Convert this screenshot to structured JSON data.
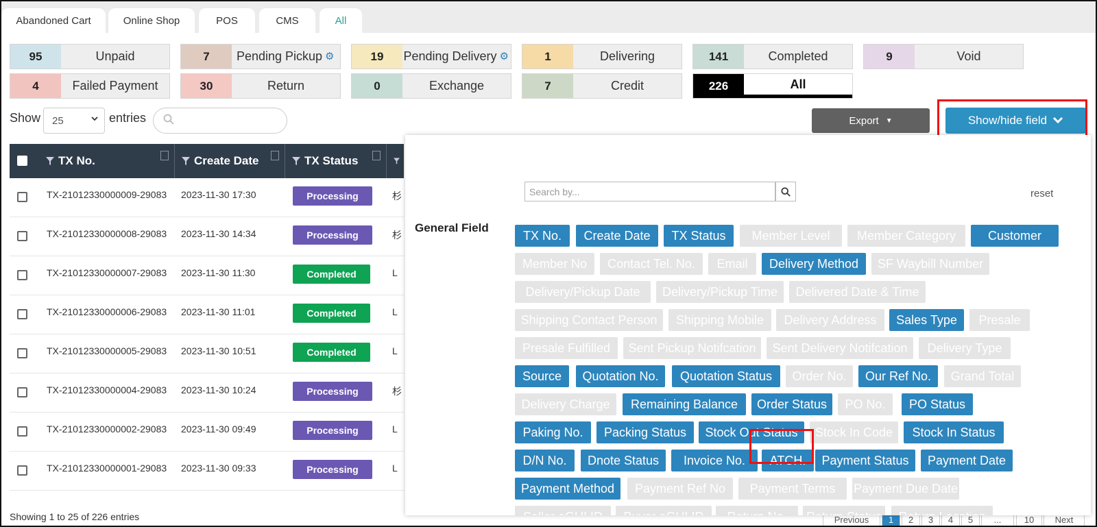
{
  "tabs": [
    "Abandoned Cart",
    "Online Shop",
    "POS",
    "CMS",
    "All"
  ],
  "active_tab": "All",
  "status_cards": [
    {
      "count": "95",
      "label": "Unpaid",
      "color": "#cfe3ea"
    },
    {
      "count": "7",
      "label": "Pending Pickup",
      "color": "#e0cbc1",
      "gear": true
    },
    {
      "count": "19",
      "label": "Pending Delivery",
      "color": "#f6e9bd",
      "gear": true
    },
    {
      "count": "1",
      "label": "Delivering",
      "color": "#f6dba6"
    },
    {
      "count": "141",
      "label": "Completed",
      "color": "#c9dcd6"
    },
    {
      "count": "9",
      "label": "Void",
      "color": "#e6d7e8"
    },
    {
      "count": "4",
      "label": "Failed Payment",
      "color": "#f2c4c0"
    },
    {
      "count": "30",
      "label": "Return",
      "color": "#f4c8c3"
    },
    {
      "count": "0",
      "label": "Exchange",
      "color": "#c6ddd6"
    },
    {
      "count": "7",
      "label": "Credit",
      "color": "#cdd9c6"
    },
    {
      "count": "226",
      "label": "All",
      "color": "#000000"
    }
  ],
  "controls": {
    "show_label": "Show",
    "entries_value": "25",
    "entries_label": "entries",
    "export_label": "Export",
    "showhide_label": "Show/hide field"
  },
  "table": {
    "headers": [
      "TX No.",
      "Create Date",
      "TX Status"
    ],
    "rows": [
      {
        "tx": "TX-21012330000009-29083",
        "date": "2023-11-30 17:30",
        "status": "Processing",
        "extra": "杉"
      },
      {
        "tx": "TX-21012330000008-29083",
        "date": "2023-11-30 14:34",
        "status": "Processing",
        "extra": "杉"
      },
      {
        "tx": "TX-21012330000007-29083",
        "date": "2023-11-30 11:30",
        "status": "Completed",
        "extra": "L"
      },
      {
        "tx": "TX-21012330000006-29083",
        "date": "2023-11-30 11:01",
        "status": "Completed",
        "extra": "L"
      },
      {
        "tx": "TX-21012330000005-29083",
        "date": "2023-11-30 10:51",
        "status": "Completed",
        "extra": "L"
      },
      {
        "tx": "TX-21012330000004-29083",
        "date": "2023-11-30 10:24",
        "status": "Processing",
        "extra": "杉"
      },
      {
        "tx": "TX-21012330000002-29083",
        "date": "2023-11-30 09:49",
        "status": "Processing",
        "extra": "L"
      },
      {
        "tx": "TX-21012330000001-29083",
        "date": "2023-11-30 09:33",
        "status": "Processing",
        "extra": "L"
      }
    ],
    "footer": "Showing 1 to 25 of 226 entries"
  },
  "pagination": [
    "Previous",
    "1",
    "2",
    "3",
    "4",
    "5",
    "...",
    "10",
    "Next"
  ],
  "panel": {
    "search_placeholder": "Search by...",
    "reset_label": "reset",
    "section_label": "General Field",
    "chips": [
      {
        "label": "TX No.",
        "on": true
      },
      {
        "label": "Create Date",
        "on": true
      },
      {
        "label": "TX Status",
        "on": true
      },
      {
        "label": "Member Level",
        "on": false
      },
      {
        "label": "Member Category",
        "on": false
      },
      {
        "label": "Customer",
        "on": true
      },
      {
        "label": "Member No",
        "on": false
      },
      {
        "label": "Contact Tel. No.",
        "on": false
      },
      {
        "label": "Email",
        "on": false
      },
      {
        "label": "Delivery Method",
        "on": true
      },
      {
        "label": "SF Waybill Number",
        "on": false
      },
      {
        "label": "Delivery/Pickup Date",
        "on": false
      },
      {
        "label": "Delivery/Pickup Time",
        "on": false
      },
      {
        "label": "Delivered Date & Time",
        "on": false
      },
      {
        "label": "Shipping Contact Person",
        "on": false
      },
      {
        "label": "Shipping Mobile",
        "on": false
      },
      {
        "label": "Delivery Address",
        "on": false
      },
      {
        "label": "Sales Type",
        "on": true
      },
      {
        "label": "Presale",
        "on": false
      },
      {
        "label": "Presale Fulfilled",
        "on": false
      },
      {
        "label": "Sent Pickup Notifcation",
        "on": false
      },
      {
        "label": "Sent Delivery Notifcation",
        "on": false
      },
      {
        "label": "Delivery Type",
        "on": false
      },
      {
        "label": "Source",
        "on": true
      },
      {
        "label": "Quotation No.",
        "on": true
      },
      {
        "label": "Quotation Status",
        "on": true
      },
      {
        "label": "Order No.",
        "on": false
      },
      {
        "label": "Our Ref No.",
        "on": true
      },
      {
        "label": "Grand Total",
        "on": false
      },
      {
        "label": "Delivery Charge",
        "on": false
      },
      {
        "label": "Remaining Balance",
        "on": true
      },
      {
        "label": "Order Status",
        "on": true
      },
      {
        "label": "PO No.",
        "on": false
      },
      {
        "label": "PO Status",
        "on": true
      },
      {
        "label": "Paking No.",
        "on": true
      },
      {
        "label": "Packing Status",
        "on": true
      },
      {
        "label": "Stock Out Status",
        "on": true
      },
      {
        "label": "Stock In Code",
        "on": false
      },
      {
        "label": "Stock In Status",
        "on": true
      },
      {
        "label": "D/N No.",
        "on": true
      },
      {
        "label": "Dnote Status",
        "on": true
      },
      {
        "label": "Invoice No.",
        "on": true
      },
      {
        "label": "ATCH.",
        "on": true
      },
      {
        "label": "Payment Status",
        "on": true
      },
      {
        "label": "Payment Date",
        "on": true
      },
      {
        "label": "Payment Method",
        "on": true
      },
      {
        "label": "Payment Ref No",
        "on": false
      },
      {
        "label": "Payment Terms",
        "on": false
      },
      {
        "label": "Payment Due Date",
        "on": false
      },
      {
        "label": "Seller eGUI ID",
        "on": false
      },
      {
        "label": "Buyer eGUI ID",
        "on": false
      },
      {
        "label": "Return No.",
        "on": false
      },
      {
        "label": "Return Status",
        "on": false
      },
      {
        "label": "Return Location",
        "on": false
      }
    ]
  }
}
